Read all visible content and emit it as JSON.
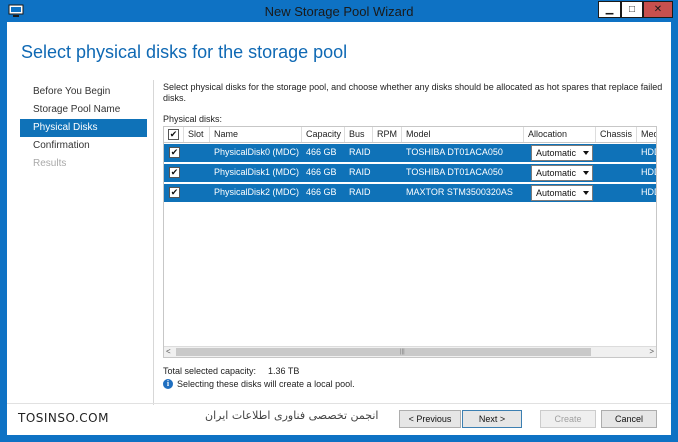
{
  "window": {
    "title": "New Storage Pool Wizard",
    "minimize_glyph": "▁",
    "maximize_glyph": "□",
    "close_glyph": "✕"
  },
  "page": {
    "title": "Select physical disks for the storage pool",
    "description": "Select physical disks for the storage pool, and choose whether any disks should be allocated as hot spares that replace failed disks.",
    "disks_label": "Physical disks:"
  },
  "nav": {
    "items": [
      {
        "label": "Before You Begin",
        "state": "normal"
      },
      {
        "label": "Storage Pool Name",
        "state": "normal"
      },
      {
        "label": "Physical Disks",
        "state": "active"
      },
      {
        "label": "Confirmation",
        "state": "normal"
      },
      {
        "label": "Results",
        "state": "disabled"
      }
    ]
  },
  "grid": {
    "columns": [
      "Slot",
      "Name",
      "Capacity",
      "Bus",
      "RPM",
      "Model",
      "Allocation",
      "Chassis",
      "Med"
    ],
    "header_check": "✔",
    "rows": [
      {
        "checked": "✔",
        "slot": "",
        "name": "PhysicalDisk0 (MDC)",
        "capacity": "466 GB",
        "bus": "RAID",
        "rpm": "",
        "model": "TOSHIBA DT01ACA050",
        "allocation": "Automatic",
        "chassis": "",
        "media": "HDD"
      },
      {
        "checked": "✔",
        "slot": "",
        "name": "PhysicalDisk1 (MDC)",
        "capacity": "466 GB",
        "bus": "RAID",
        "rpm": "",
        "model": "TOSHIBA DT01ACA050",
        "allocation": "Automatic",
        "chassis": "",
        "media": "HDD"
      },
      {
        "checked": "✔",
        "slot": "",
        "name": "PhysicalDisk2 (MDC)",
        "capacity": "466 GB",
        "bus": "RAID",
        "rpm": "",
        "model": "MAXTOR STM3500320AS",
        "allocation": "Automatic",
        "chassis": "",
        "media": "HDD"
      }
    ],
    "scroll_left": "<",
    "scroll_right": ">",
    "scroll_grip": "|||"
  },
  "summary": {
    "total_label": "Total selected capacity:",
    "total_value": "1.36 TB",
    "info_icon": "i",
    "info_text": "Selecting these disks will create a local pool."
  },
  "buttons": {
    "previous": "< Previous",
    "next": "Next >",
    "create": "Create",
    "cancel": "Cancel"
  },
  "watermark": {
    "left": "TOSINSO.COM",
    "right": "انجمن تخصصی فناوری اطلاعات ایران"
  },
  "colors": {
    "accent": "#0f72b8",
    "titlebar": "#0e72c4",
    "close": "#c7504e"
  }
}
